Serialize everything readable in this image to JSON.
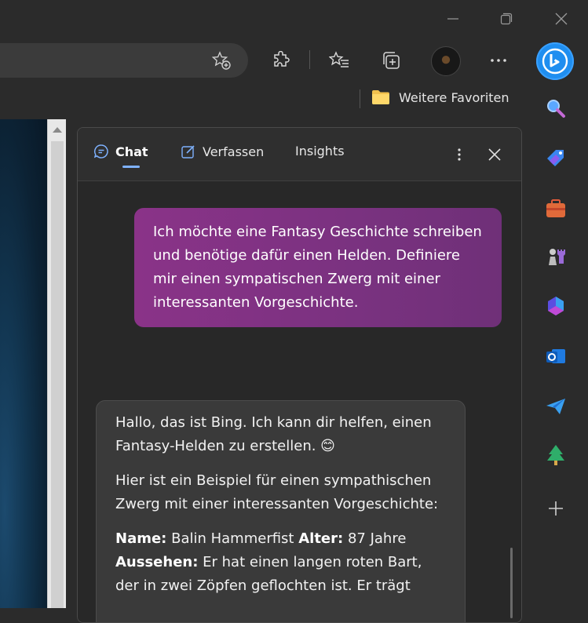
{
  "titlebar": {
    "controls": [
      {
        "name": "minimize-icon"
      },
      {
        "name": "restore-icon"
      },
      {
        "name": "close-icon"
      }
    ]
  },
  "toolbar": {
    "icons": [
      "favorite-add-icon",
      "extensions-icon",
      "favorites-icon",
      "collections-icon",
      "profile-avatar",
      "more-icon"
    ]
  },
  "favorites_bar": {
    "folder_label": "Weitere Favoriten",
    "folder_icon": "folder-icon",
    "folder_color": "#f2c14e"
  },
  "chat_panel": {
    "tabs": [
      {
        "label": "Chat",
        "active": true
      },
      {
        "label": "Verfassen",
        "active": false
      },
      {
        "label": "Insights",
        "active": false
      }
    ],
    "accent": "#7fb2ff",
    "user_message": "Ich möchte eine Fantasy Geschichte schreiben und benötige dafür einen Helden. Definiere mir einen sympatischen Zwerg mit einer interessanten Vorgeschichte.",
    "bot_message": {
      "intro": "Hallo, das ist Bing. Ich kann dir helfen, einen Fantasy-Helden zu erstellen. 😊",
      "lead": "Hier ist ein Beispiel für einen sympathischen Zwerg mit einer interessanten Vorgeschichte:",
      "name_label": "Name:",
      "name_value": " Balin Hammerfist ",
      "age_label": "Alter:",
      "age_value": " 87 Jahre",
      "looks_label": "Aussehen:",
      "looks_value": " Er hat einen langen roten Bart, der in zwei Zöpfen geflochten ist. Er trägt"
    },
    "user_bubble_color": "#7f3283"
  },
  "sidebar": {
    "icons": [
      "bing-icon",
      "search-icon",
      "shopping-tag-icon",
      "tools-icon",
      "games-icon",
      "microsoft-365-icon",
      "outlook-icon",
      "send-icon",
      "tree-icon",
      "add-icon"
    ]
  }
}
